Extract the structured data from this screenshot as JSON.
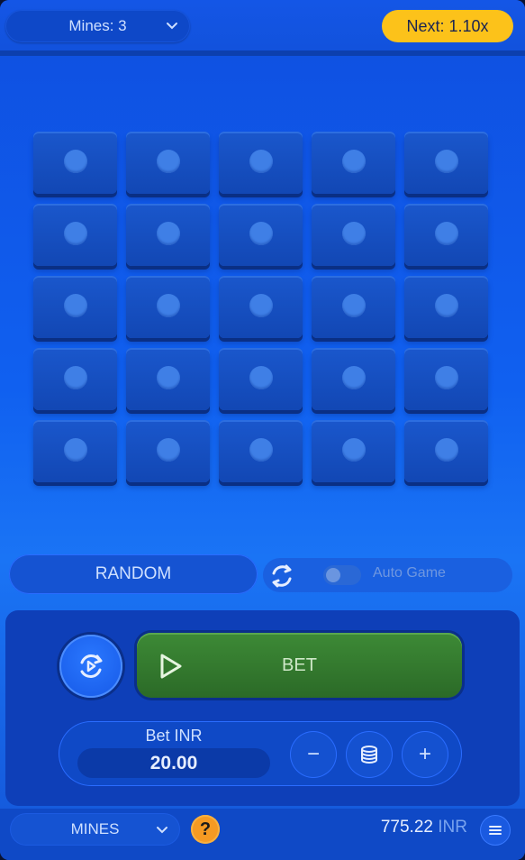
{
  "header": {
    "mines_select_label": "Mines: 3",
    "next_multiplier_label": "Next: 1.10x"
  },
  "grid": {
    "rows": 5,
    "cols": 5,
    "tile_state": "hidden"
  },
  "controls": {
    "random_label": "RANDOM",
    "auto_game_label": "Auto Game",
    "auto_game_enabled": false
  },
  "bet": {
    "bet_button_label": "BET",
    "amount_label": "Bet INR",
    "amount_value": "20.00",
    "minus_label": "−",
    "plus_label": "+"
  },
  "footer": {
    "game_select_label": "MINES",
    "help_label": "?",
    "balance_value": "775.22",
    "balance_currency": "INR"
  },
  "icons": {
    "mines_chevron": "chevron-down-icon",
    "replay": "replay-icon",
    "play": "play-icon",
    "coins": "coins-stack-icon",
    "auto": "refresh-icon",
    "menu": "hamburger-menu-icon"
  },
  "colors": {
    "accent_next": "#fcc21a",
    "bet_green": "#3d8a36",
    "help_orange": "#f59a23"
  }
}
